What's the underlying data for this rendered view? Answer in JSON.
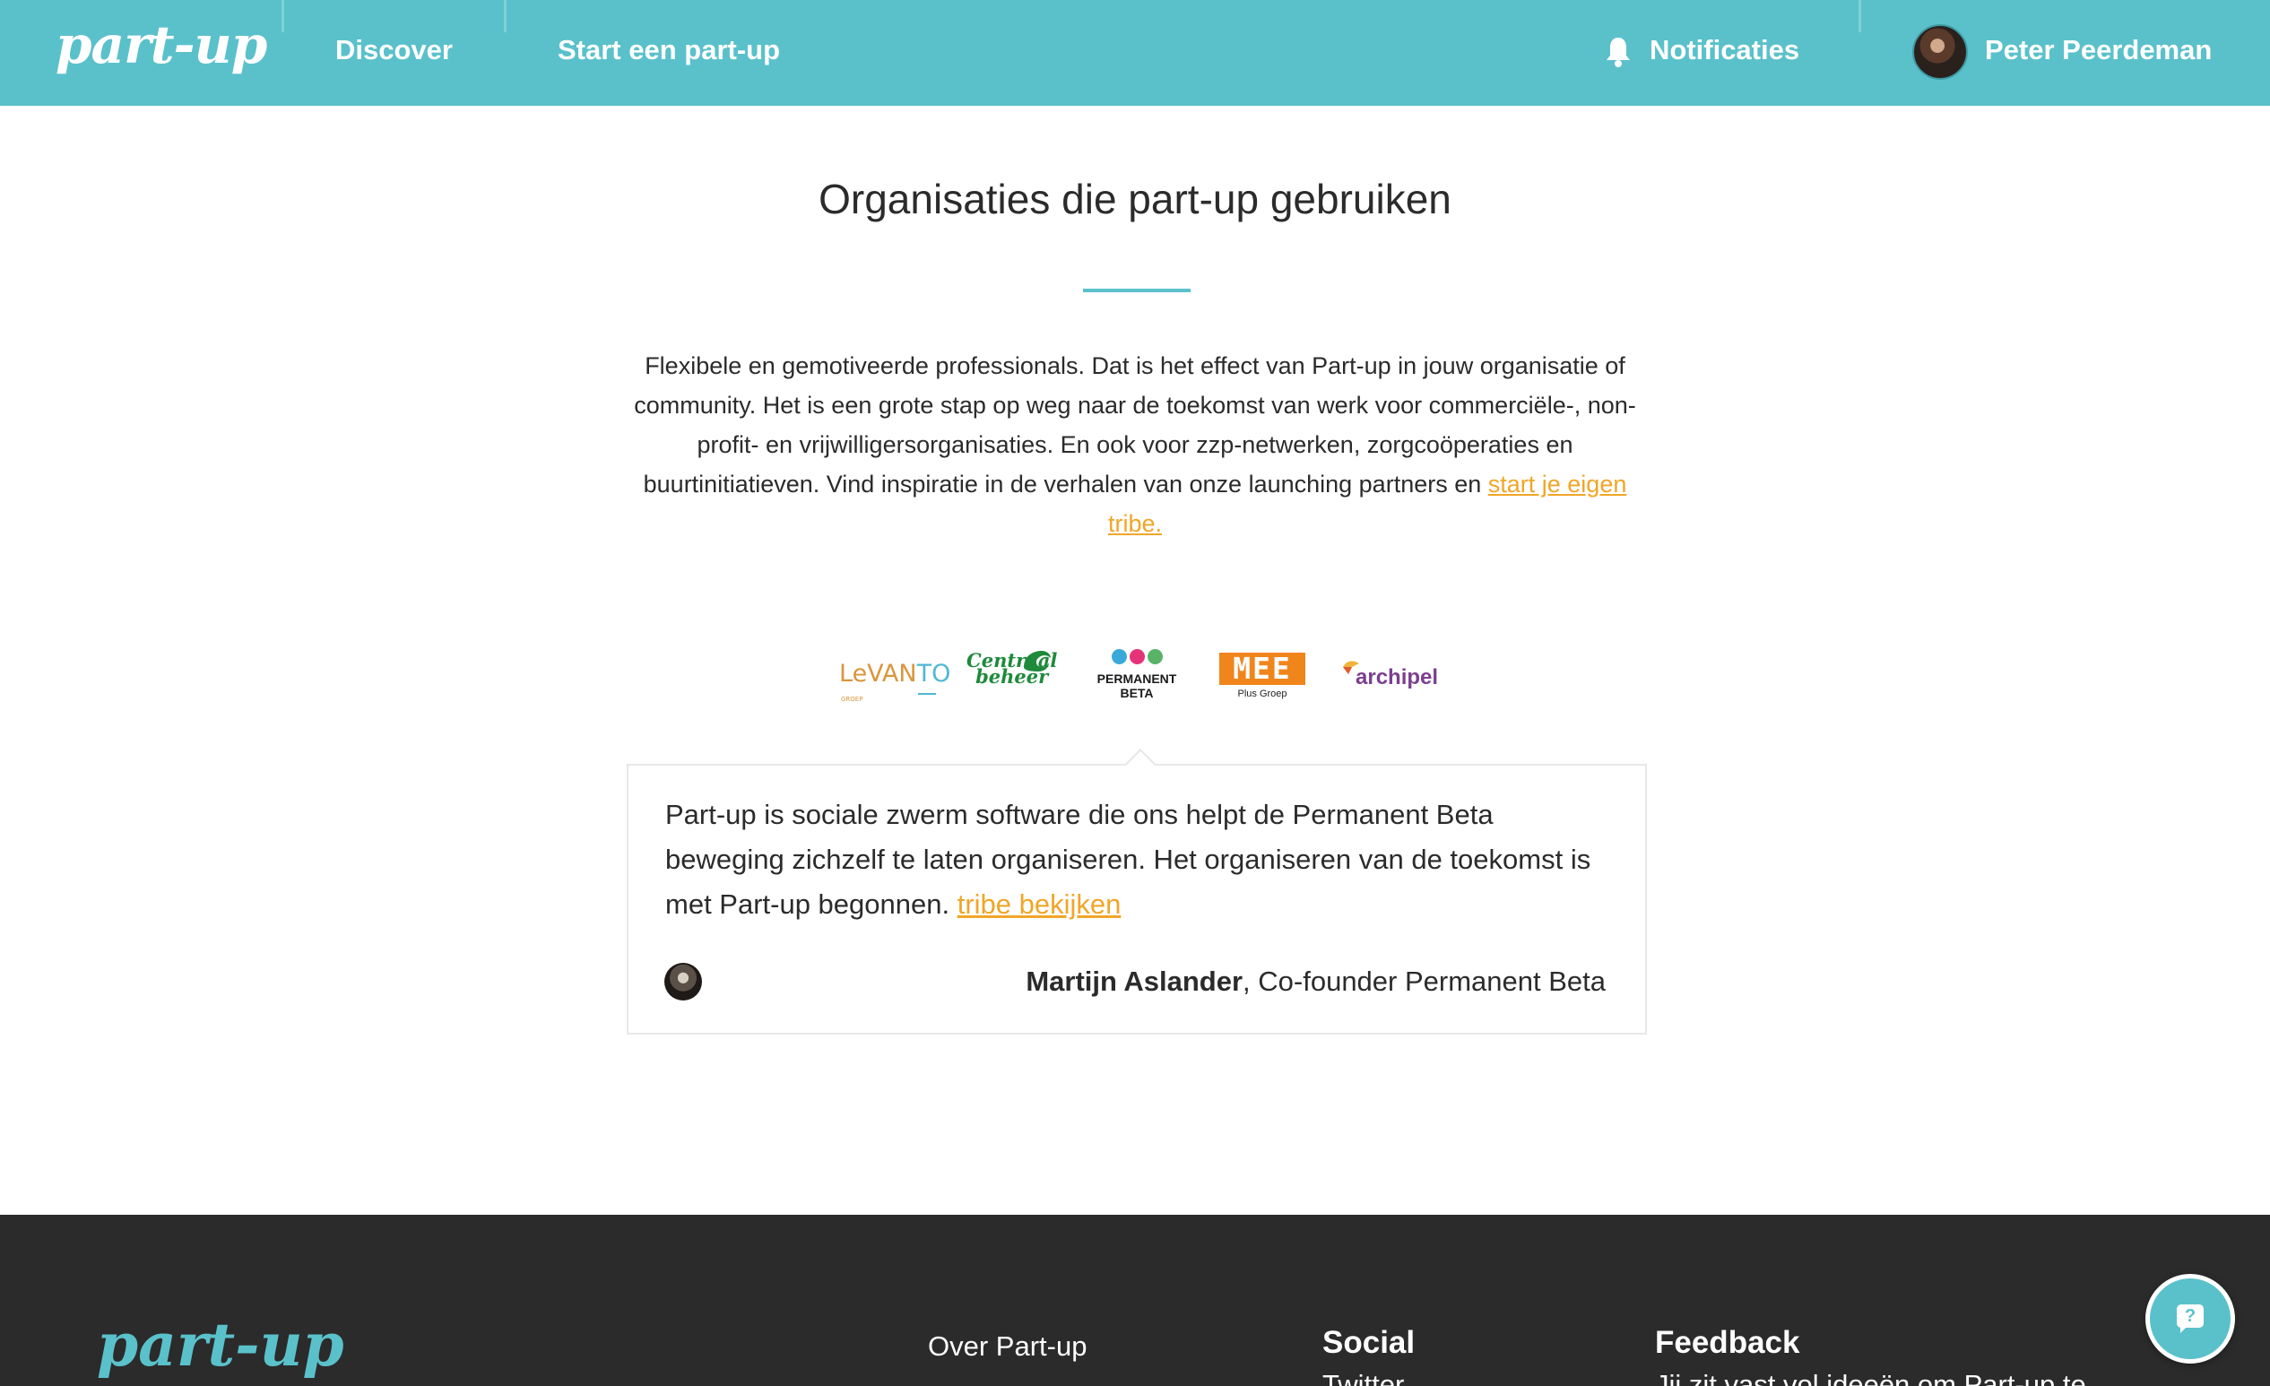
{
  "header": {
    "logo": "part-up",
    "nav": [
      "Discover",
      "Start een part-up"
    ],
    "notifications_label": "Notificaties",
    "user_name": "Peter Peerdeman",
    "brand_color": "#5ac1cb"
  },
  "main": {
    "title": "Organisaties die part-up gebruiken",
    "intro_text": "Flexibele en gemotiveerde professionals. Dat is het effect van Part-up in jouw organisatie of community. Het is een grote stap op weg naar de toekomst van werk voor commerciële-, non-profit- en vrijwilligersorganisaties. En ook voor zzp-netwerken, zorgcoöperaties en buurtinitiatieven. Vind inspiratie in de verhalen van onze launching partners en ",
    "intro_link": "start je eigen tribe.",
    "link_color": "#f0a628",
    "organizations": [
      {
        "name": "Levanto",
        "logo_text": "LeVanTO",
        "sub": "GROEP"
      },
      {
        "name": "Centraal Beheer",
        "logo_text": "Centraal beheer"
      },
      {
        "name": "Permanent Beta",
        "logo_text": "PERMANENT BETA",
        "selected": true
      },
      {
        "name": "MEE Plus Groep",
        "logo_text": "MEE",
        "sub": "Plus Groep"
      },
      {
        "name": "Archipel",
        "logo_text": "archipel"
      }
    ],
    "quote": {
      "text": "Part-up is sociale zwerm software die ons helpt de Permanent Beta beweging zichzelf te laten organiseren. Het organiseren van de toekomst is met Part-up begonnen. ",
      "link": "tribe bekijken",
      "author_name": "Martijn Aslander",
      "author_role": ", Co-founder Permanent Beta"
    }
  },
  "footer": {
    "logo": "part-up",
    "link": "Over Part-up",
    "social_heading": "Social",
    "social_first": "Twitter",
    "feedback_heading": "Feedback",
    "feedback_text": "Jij zit vast vol ideeën om Part-up te"
  },
  "icons": [
    "bell-icon",
    "help-icon"
  ]
}
